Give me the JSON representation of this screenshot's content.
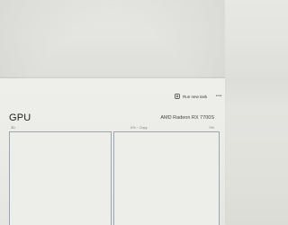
{
  "toolbar": {
    "run_new_task_label": "Run new task",
    "more_label": "•••"
  },
  "gpu": {
    "title": "GPU",
    "model": "AMD Radeon RX 7700S",
    "graph_left_label": "3D",
    "graph_mid_label": "0% ~ Copy",
    "graph_right_label": "0%"
  },
  "icons": {
    "run_task": "run-task-icon"
  }
}
